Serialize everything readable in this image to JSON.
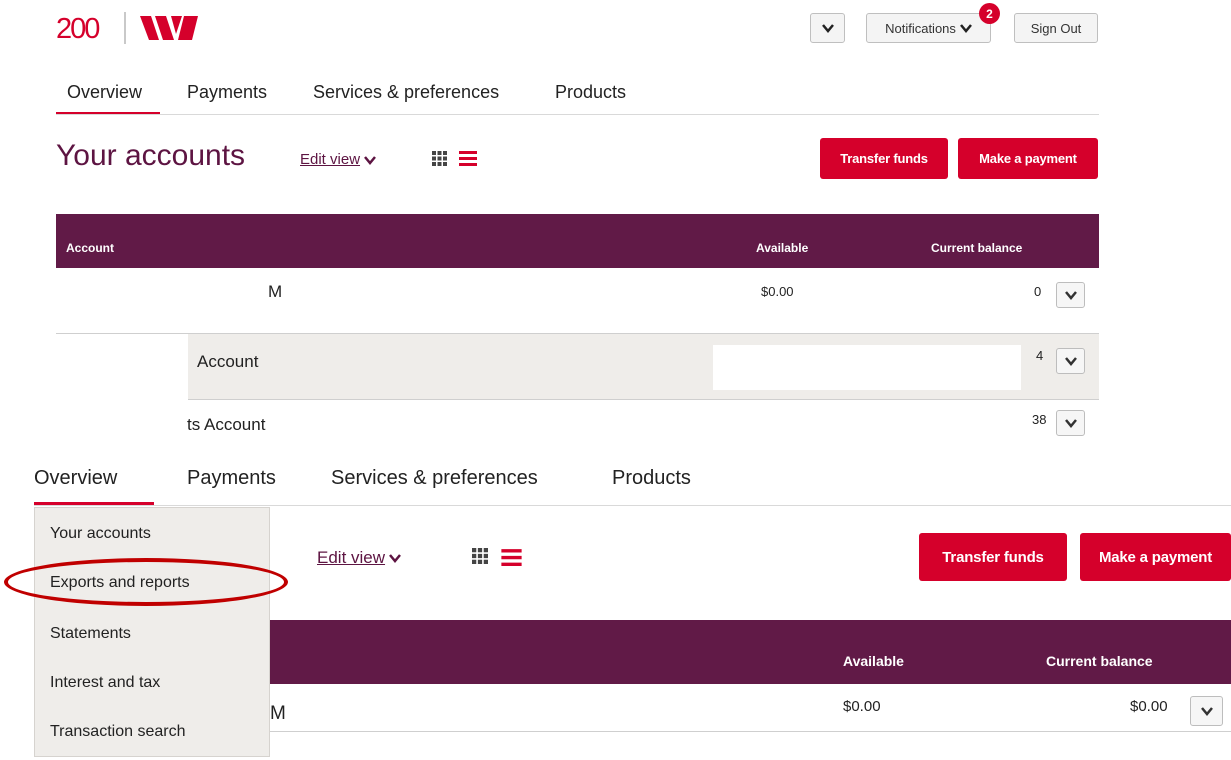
{
  "header": {
    "logo_text": "200",
    "logo_mark": "westpac-w-logo",
    "notifications_label": "Notifications",
    "notifications_count": "2",
    "signout_label": "Sign Out"
  },
  "nav_top": {
    "tabs": [
      {
        "label": "Overview",
        "active": true
      },
      {
        "label": "Payments"
      },
      {
        "label": "Services & preferences"
      },
      {
        "label": "Products"
      }
    ]
  },
  "accounts_top": {
    "title": "Your accounts",
    "edit_view": "Edit view",
    "transfer_label": "Transfer funds",
    "payment_label": "Make a payment",
    "columns": {
      "account": "Account",
      "available": "Available",
      "balance": "Current balance"
    },
    "rows": [
      {
        "name": "M",
        "available": "$0.00",
        "balance": "0"
      },
      {
        "name": "Account",
        "available": "",
        "balance": "4"
      },
      {
        "name": "ts Account",
        "available": "",
        "balance": "38"
      }
    ]
  },
  "nav_bottom": {
    "tabs": [
      {
        "label": "Overview",
        "active": true
      },
      {
        "label": "Payments"
      },
      {
        "label": "Services & preferences"
      },
      {
        "label": "Products"
      }
    ]
  },
  "dropdown": {
    "items": [
      "Your accounts",
      "Exports and reports",
      "Statements",
      "Interest and tax",
      "Transaction search"
    ],
    "highlighted": "Exports and reports"
  },
  "accounts_bottom": {
    "edit_view": "Edit view",
    "transfer_label": "Transfer funds",
    "payment_label": "Make a payment",
    "columns": {
      "available": "Available",
      "balance": "Current balance"
    },
    "row": {
      "name": "M",
      "available": "$0.00",
      "balance": "$0.00"
    }
  },
  "colors": {
    "brand_red": "#d5002b",
    "brand_plum": "#611a47",
    "highlight_ellipse": "#c00000"
  }
}
